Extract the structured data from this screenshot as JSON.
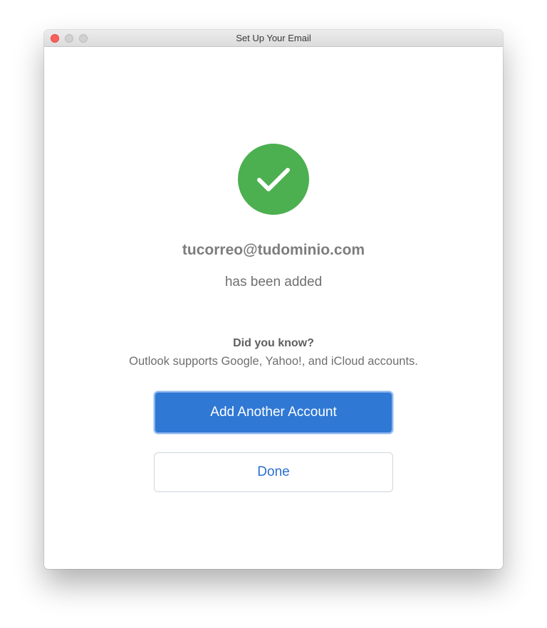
{
  "window": {
    "title": "Set Up Your Email"
  },
  "success": {
    "icon": "checkmark-circle-icon",
    "color": "#4caf50"
  },
  "account": {
    "email": "tucorreo@tudominio.com",
    "status": "has been added"
  },
  "tip": {
    "title": "Did you know?",
    "body": "Outlook supports Google, Yahoo!, and iCloud accounts."
  },
  "actions": {
    "add_another_label": "Add Another Account",
    "done_label": "Done"
  },
  "colors": {
    "primary": "#2f78d4",
    "link": "#2a6fd0",
    "close_button": "#fc605c"
  }
}
